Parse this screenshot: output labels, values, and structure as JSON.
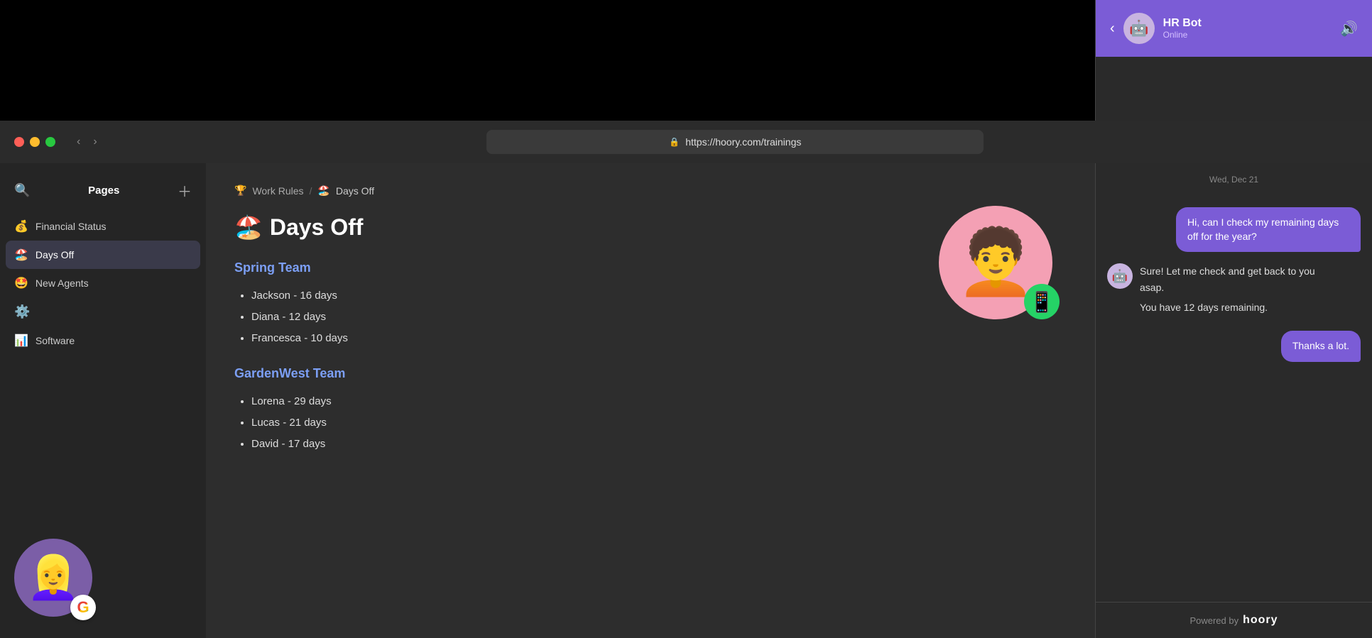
{
  "browser": {
    "url": "https://hoory.com/trainings",
    "lock_icon": "🔒"
  },
  "sidebar": {
    "title": "Pages",
    "items": [
      {
        "id": "financial-status",
        "icon": "💰",
        "label": "Financial Status",
        "active": false
      },
      {
        "id": "days-off",
        "icon": "🏖️",
        "label": "Days Off",
        "active": true
      },
      {
        "id": "new-agents",
        "icon": "🤩",
        "label": "New Agents",
        "active": false
      },
      {
        "id": "software",
        "icon": "📊",
        "label": "Software",
        "active": false
      }
    ]
  },
  "breadcrumb": {
    "parent_icon": "🏆",
    "parent_label": "Work Rules",
    "separator": "/",
    "current_icon": "🏖️",
    "current_label": "Days Off"
  },
  "page": {
    "title_icon": "🏖️",
    "title": "Days Off",
    "teams": [
      {
        "name": "Spring Team",
        "color": "spring",
        "members": [
          "Jackson - 16 days",
          "Diana - 12 days",
          "Francesca - 10 days"
        ]
      },
      {
        "name": "GardenWest Team",
        "color": "garden",
        "members": [
          "Lorena - 29 days",
          "Lucas - 21 days",
          "David - 17 days"
        ]
      }
    ]
  },
  "chat": {
    "header": {
      "bot_name": "HR Bot",
      "status": "Online",
      "date": "Wed, Dec 21"
    },
    "messages": [
      {
        "type": "user",
        "text": "Hi, can I check my remaining days off for the year?"
      },
      {
        "type": "bot",
        "line1": "Sure! Let me check and get back to you asap.",
        "line2": "You have 12 days remaining."
      },
      {
        "type": "user",
        "text": "Thanks a lot."
      }
    ],
    "footer": {
      "powered_by": "Powered by",
      "brand": "hoory"
    }
  }
}
